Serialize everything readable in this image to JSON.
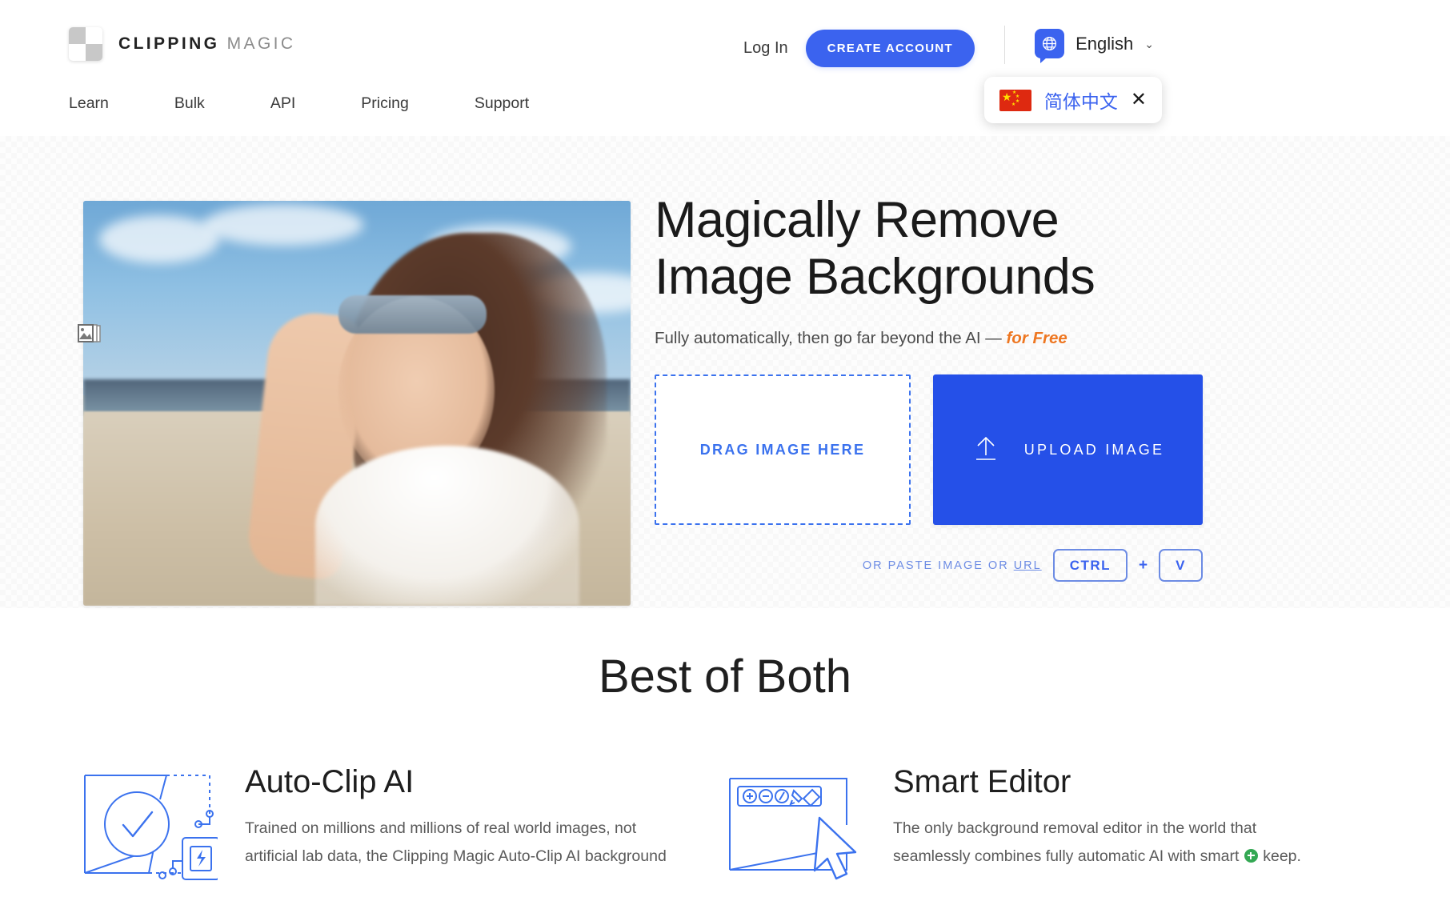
{
  "brand": {
    "name_bold": "CLIPPING",
    "name_light": "MAGIC",
    "logo_icon": "checkerboard-transparency-icon"
  },
  "nav": {
    "items": [
      {
        "label": "Learn"
      },
      {
        "label": "Bulk"
      },
      {
        "label": "API"
      },
      {
        "label": "Pricing"
      },
      {
        "label": "Support"
      }
    ]
  },
  "account": {
    "login_label": "Log In",
    "create_account_label": "CREATE ACCOUNT",
    "create_account_color": "#3b63ef"
  },
  "language": {
    "icon": "globe-icon",
    "selected": "English",
    "caret": "⌄",
    "popup": {
      "flag_icon": "china-flag-icon",
      "label": "简体中文",
      "close_icon": "✕",
      "link_color": "#3b63ef"
    }
  },
  "hero": {
    "sample_images_icon": "stacked-photos-icon",
    "photo_alt": "Smiling woman on a beach lifting sunglasses",
    "headline": "Magically Remove\nImage Backgrounds",
    "subhead_plain": "Fully automatically, then go far beyond the AI — ",
    "subhead_accent": "for Free",
    "accent_color": "#ee7722",
    "dropzone_label": "DRAG IMAGE HERE",
    "upload_label": "UPLOAD IMAGE",
    "upload_icon": "upload-arrow-icon",
    "upload_color": "#2550e8",
    "paste": {
      "text_before": "OR PASTE IMAGE OR ",
      "url_label": "URL",
      "key_ctrl": "CTRL",
      "plus": "+",
      "key_v": "V"
    }
  },
  "best_of_both": {
    "title": "Best of Both",
    "features": [
      {
        "icon": "ai-checkmark-chip-icon",
        "title": "Auto-Clip AI",
        "body": "Trained on millions and millions of real world images, not artificial lab data, the Clipping Magic Auto-Clip AI background"
      },
      {
        "icon": "smart-editor-cursor-icon",
        "title": "Smart Editor",
        "body_before": "The only background removal editor in the world that seamlessly combines fully automatic AI with smart ",
        "body_after": " keep."
      }
    ]
  }
}
